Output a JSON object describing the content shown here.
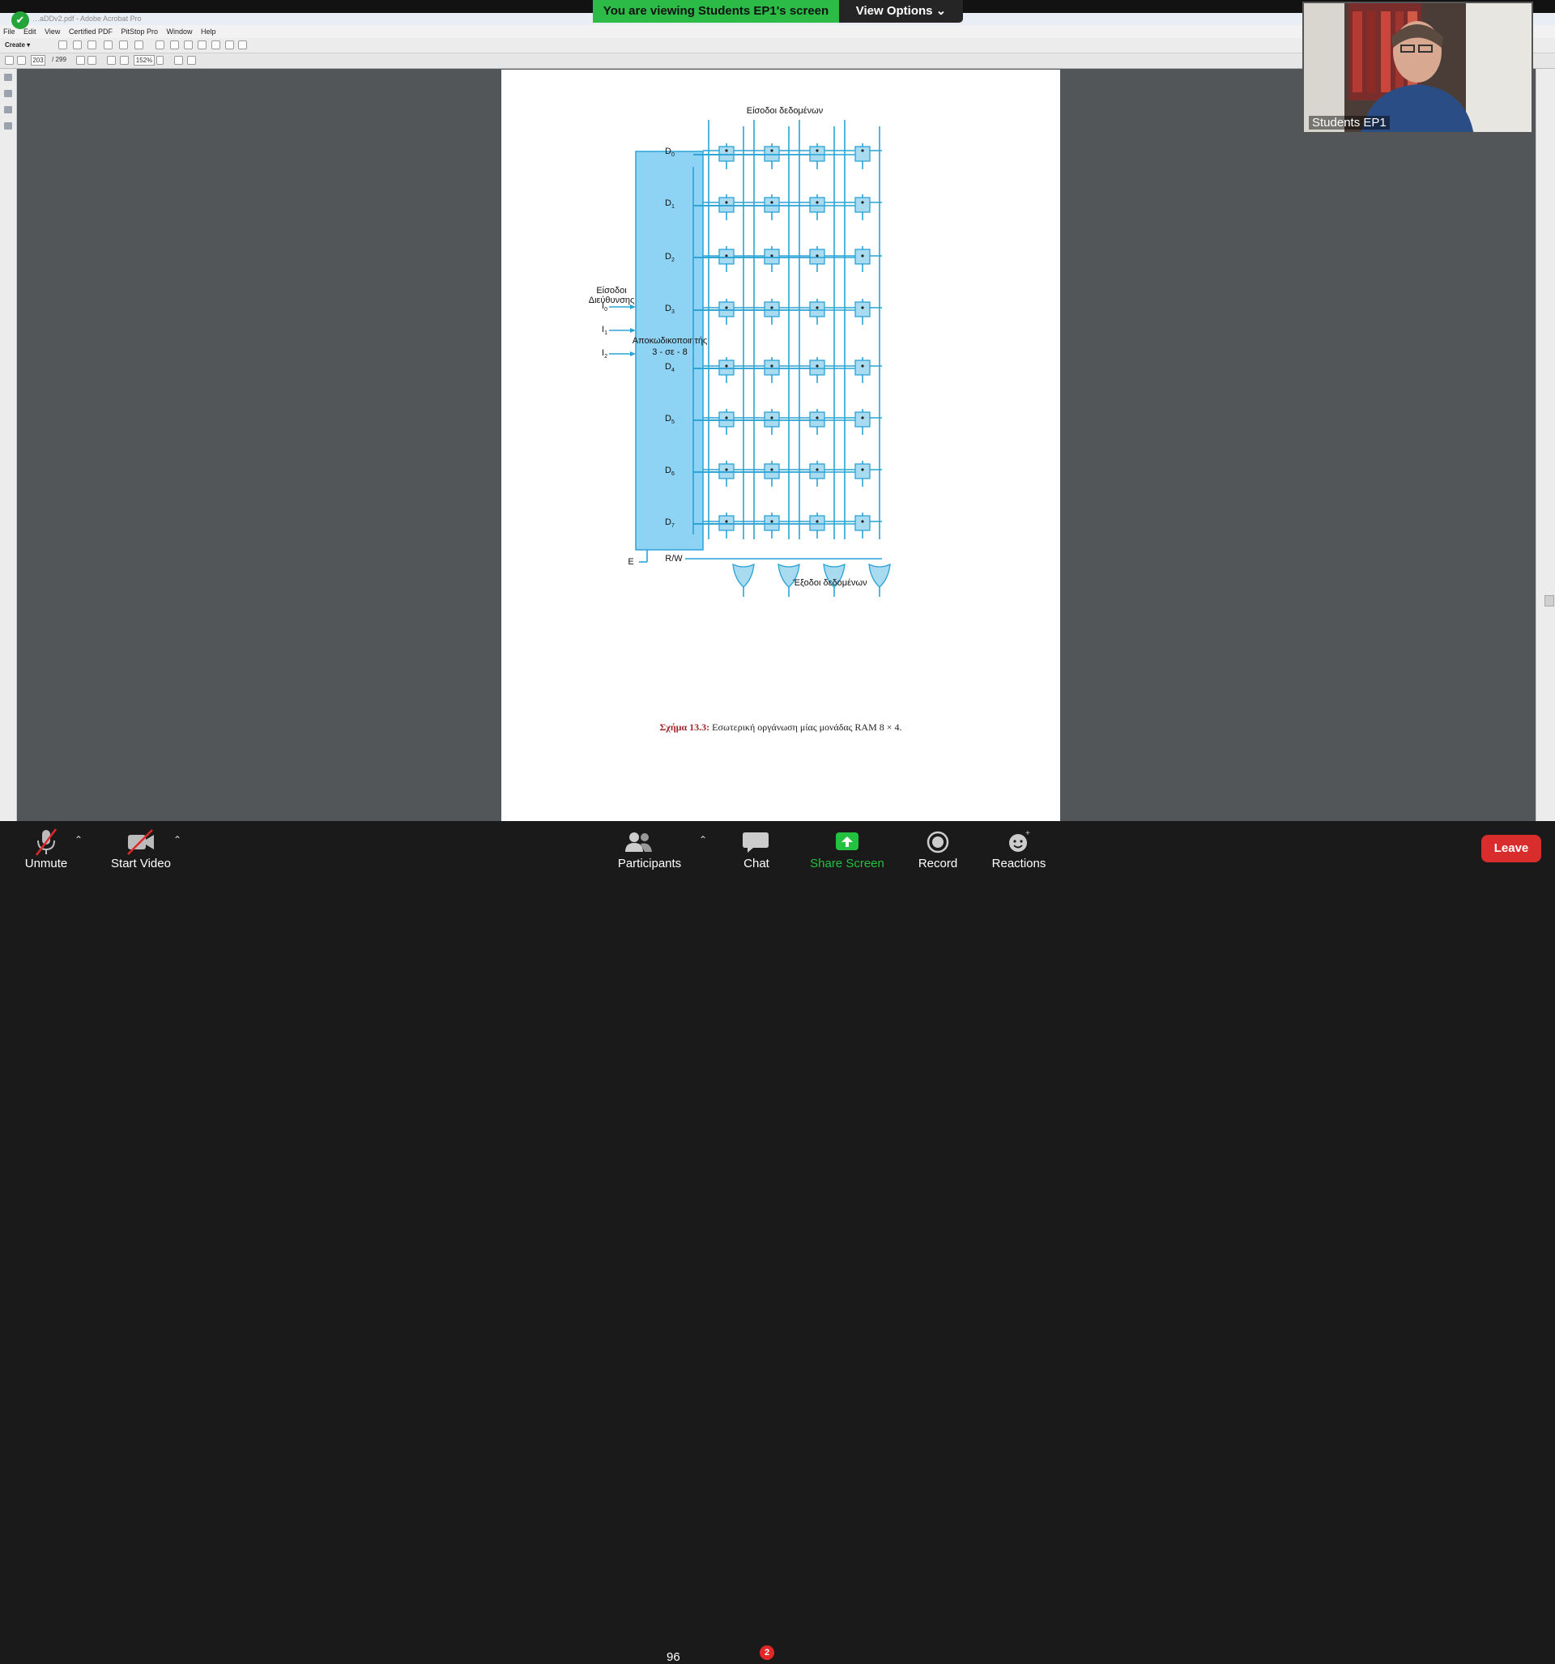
{
  "banner": {
    "viewing_text": "You are viewing Students EP1's screen",
    "view_options_label": "View Options"
  },
  "acrobat": {
    "title": "…aDDv2.pdf - Adobe Acrobat Pro",
    "menu": [
      "File",
      "Edit",
      "View",
      "Certified PDF",
      "PitStop Pro",
      "Window",
      "Help"
    ],
    "create_label": "Create",
    "page_current": "203",
    "page_total": "/ 299",
    "zoom": "152%"
  },
  "pdf": {
    "diagram": {
      "top_label": "Είσοδοι δεδομένων",
      "bottom_label": "Έξοδοι δεδομένων",
      "address_label_1": "Είσοδοι",
      "address_label_2": "Διεύθυνσης",
      "decoder_line_1": "Αποκωδικοποιητής",
      "decoder_line_2": "3 - σε - 8",
      "inputs": [
        "I0",
        "I1",
        "I2"
      ],
      "outputs": [
        "D0",
        "D1",
        "D2",
        "D3",
        "D4",
        "D5",
        "D6",
        "D7"
      ],
      "enable_label": "E",
      "rw_label": "R/W",
      "cell_color": "#a8dbf0",
      "wire_color": "#2aa3d6",
      "decoder_color": "#8fd3f4"
    },
    "caption_label": "Σχήμα 13.3:",
    "caption_text": "Εσωτερική οργάνωση μίας μονάδας RAM 8 × 4."
  },
  "webcam": {
    "name": "Students EP1"
  },
  "toolbar": {
    "unmute_label": "Unmute",
    "start_video_label": "Start Video",
    "participants_label": "Participants",
    "participants_count": "96",
    "chat_label": "Chat",
    "chat_badge": "2",
    "share_label": "Share Screen",
    "record_label": "Record",
    "reactions_label": "Reactions",
    "leave_label": "Leave",
    "share_color": "#23c140",
    "leave_color": "#d92c2c"
  }
}
